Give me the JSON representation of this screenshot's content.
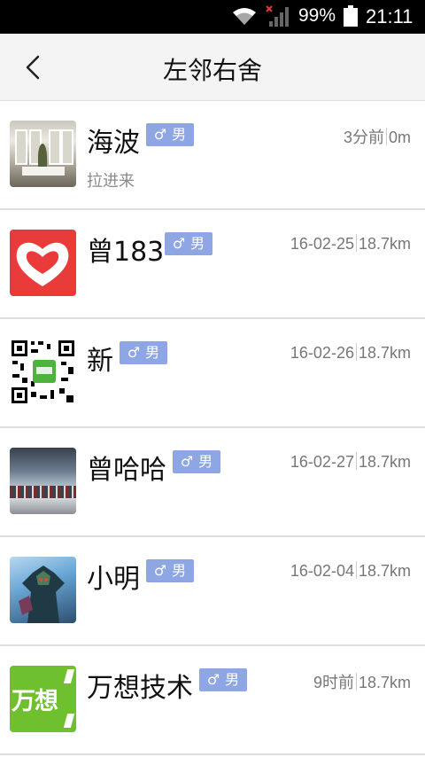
{
  "status_bar": {
    "battery_percent": "99%",
    "time": "21:11",
    "icons": [
      "wifi-icon",
      "signal-icon",
      "battery-icon"
    ]
  },
  "header": {
    "title": "左邻右舍",
    "back_icon": "chevron-left-icon"
  },
  "colors": {
    "gender_badge": "#8fa6e4",
    "divider": "#dedede",
    "header_bg": "#f4f4f4"
  },
  "contacts": [
    {
      "name": "海波",
      "gender": "男",
      "gender_symbol": "♂",
      "time": "3分前",
      "distance": "0m",
      "subtitle": "拉进来"
    },
    {
      "name": "曾183",
      "gender": "男",
      "gender_symbol": "♂",
      "time": "16-02-25",
      "distance": "18.7km",
      "subtitle": ""
    },
    {
      "name": "新",
      "gender": "男",
      "gender_symbol": "♂",
      "time": "16-02-26",
      "distance": "18.7km",
      "subtitle": ""
    },
    {
      "name": "曾哈哈",
      "gender": "男",
      "gender_symbol": "♂",
      "time": "16-02-27",
      "distance": "18.7km",
      "subtitle": ""
    },
    {
      "name": "小明",
      "gender": "男",
      "gender_symbol": "♂",
      "time": "16-02-04",
      "distance": "18.7km",
      "subtitle": ""
    },
    {
      "name": "万想技术",
      "gender": "男",
      "gender_symbol": "♂",
      "time": "9时前",
      "distance": "18.7km",
      "subtitle": "",
      "avatar_text": "万想"
    }
  ]
}
